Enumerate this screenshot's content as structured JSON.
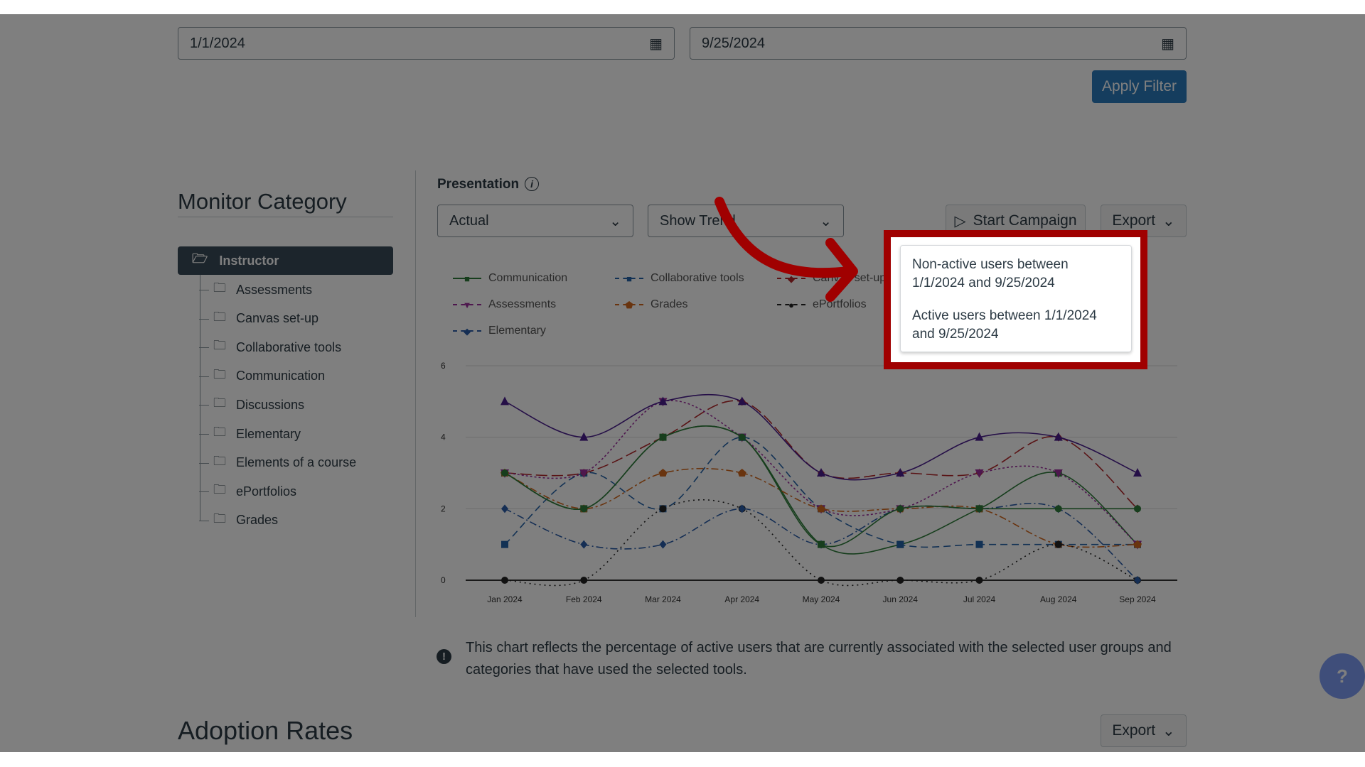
{
  "filters": {
    "start_date": "1/1/2024",
    "end_date": "9/25/2024",
    "apply_label": "Apply Filter"
  },
  "sidebar": {
    "title": "Monitor Category",
    "root": "Instructor",
    "items": [
      "Assessments",
      "Canvas set-up",
      "Collaborative tools",
      "Communication",
      "Discussions",
      "Elementary",
      "Elements of a course",
      "ePortfolios",
      "Grades"
    ]
  },
  "presentation": {
    "label": "Presentation",
    "select_value": "Actual",
    "trend_value": "Show Trend",
    "start_campaign": "Start Campaign",
    "export": "Export"
  },
  "tooltip": {
    "line1": "Non-active users between 1/1/2024 and 9/25/2024",
    "line2": "Active users between 1/1/2024 and 9/25/2024"
  },
  "note": "This chart reflects the percentage of active users that are currently associated with the selected user groups and categories that have used the selected tools.",
  "adoption": {
    "title": "Adoption Rates",
    "export": "Export"
  },
  "colors": {
    "accent": "#2b7abc",
    "highlight": "#a00000",
    "help": "#3f4ea8"
  },
  "chart_data": {
    "type": "line",
    "categories": [
      "Jan 2024",
      "Feb 2024",
      "Mar 2024",
      "Apr 2024",
      "May 2024",
      "Jun 2024",
      "Jul 2024",
      "Aug 2024",
      "Sep 2024"
    ],
    "yticks": [
      0,
      2,
      4,
      6
    ],
    "ylim": [
      0,
      6
    ],
    "grid": true,
    "legend": "top",
    "series": [
      {
        "name": "Communication",
        "color": "#2e7d3a",
        "dash": "",
        "marker": "square",
        "values": [
          3,
          2,
          4,
          4,
          1,
          1,
          2,
          3,
          1
        ]
      },
      {
        "name": "Collaborative tools",
        "color": "#2563a8",
        "dash": "10,6",
        "marker": "square",
        "values": [
          1,
          3,
          2,
          4,
          2,
          1,
          1,
          1,
          1
        ]
      },
      {
        "name": "Canvas set-up",
        "color": "#b3262a",
        "dash": "16,6",
        "marker": "diamond",
        "values": [
          3,
          3,
          4,
          5,
          3,
          3,
          3,
          4,
          2
        ]
      },
      {
        "name": "Assessments",
        "color": "#9c2f9c",
        "dash": "3,3",
        "marker": "tri-down",
        "values": [
          3,
          3,
          5,
          4,
          2,
          2,
          3,
          3,
          1
        ]
      },
      {
        "name": "Grades",
        "color": "#d2691e",
        "dash": "10,4,3,4",
        "marker": "pentagon",
        "values": [
          3,
          2,
          3,
          3,
          2,
          2,
          2,
          1,
          1
        ]
      },
      {
        "name": "ePortfolios",
        "color": "#222222",
        "dash": "2,5",
        "marker": "circle",
        "values": [
          0,
          0,
          2,
          2,
          0,
          0,
          0,
          1,
          0
        ]
      },
      {
        "name": "Elementary",
        "color": "#2a5da8",
        "dash": "10,4,2,4",
        "marker": "diamond",
        "values": [
          2,
          1,
          1,
          2,
          1,
          2,
          2,
          2,
          0
        ]
      },
      {
        "color": "#4b1f8f",
        "dash": "",
        "marker": "tri-up",
        "values": [
          5,
          4,
          5,
          5,
          3,
          3,
          4,
          4,
          3
        ]
      },
      {
        "color": "#2e7d3a",
        "dash": "",
        "marker": "circle",
        "values": [
          3,
          2,
          4,
          4,
          1,
          2,
          2,
          2,
          2
        ]
      }
    ]
  }
}
